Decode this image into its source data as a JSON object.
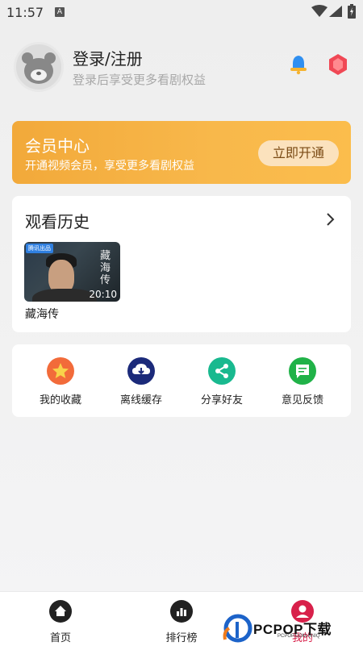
{
  "status_bar": {
    "time": "11:57",
    "notification_icon_letter": "A"
  },
  "profile": {
    "title": "登录/注册",
    "subtitle": "登录后享受更多看剧权益"
  },
  "vip": {
    "title": "会员中心",
    "subtitle": "开通视频会员，享受更多看剧权益",
    "button_label": "立即开通",
    "colors": {
      "start": "#f2a93a",
      "end": "#fbbd4c"
    }
  },
  "history": {
    "title": "观看历史",
    "items": [
      {
        "name": "藏海传",
        "duration": "20:10",
        "badge": "腾讯出品",
        "poster_text": "藏海传"
      }
    ]
  },
  "tools": [
    {
      "label": "我的收藏",
      "icon": "star-icon",
      "color": "#f26b3a"
    },
    {
      "label": "离线缓存",
      "icon": "download-cloud-icon",
      "color": "#1b2a7a"
    },
    {
      "label": "分享好友",
      "icon": "share-icon",
      "color": "#19b98f"
    },
    {
      "label": "意见反馈",
      "icon": "feedback-icon",
      "color": "#20b248"
    }
  ],
  "bottom_nav": [
    {
      "label": "首页",
      "icon": "home-icon"
    },
    {
      "label": "排行榜",
      "icon": "ranking-icon"
    },
    {
      "label": "我的",
      "icon": "profile-icon",
      "active": true,
      "color": "#d8204a"
    }
  ],
  "watermark": {
    "brand": "PCPOP下载",
    "url": "PCPOP.COM.UNIQ"
  }
}
